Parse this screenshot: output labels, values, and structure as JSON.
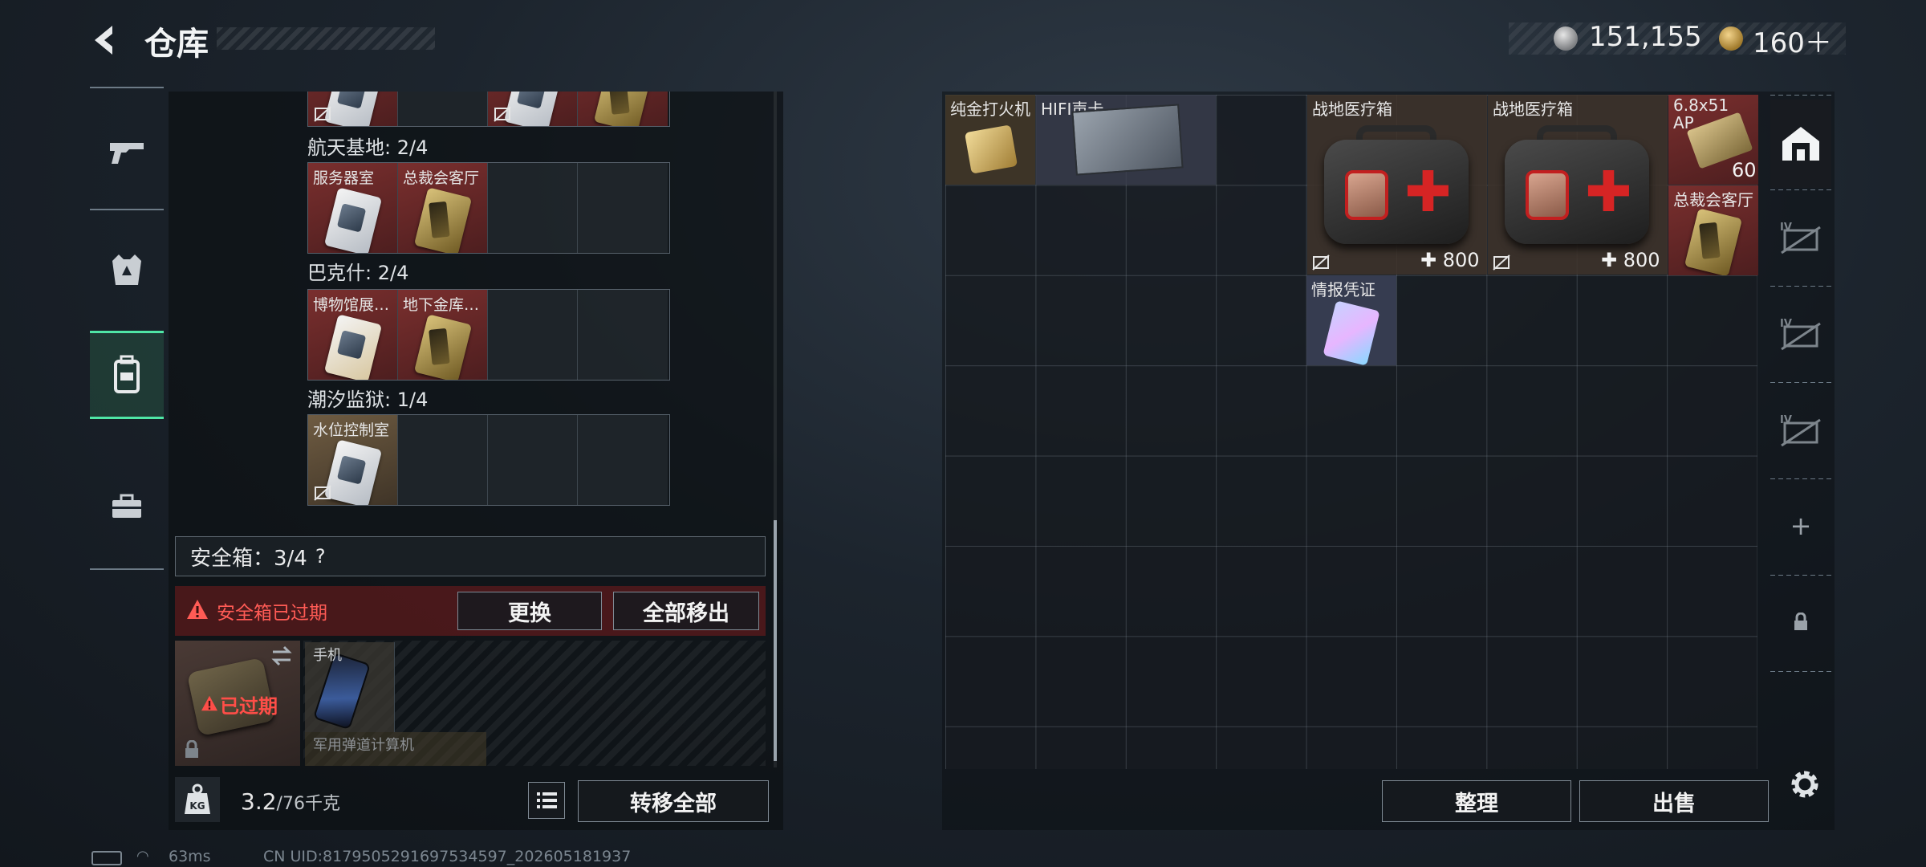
{
  "header": {
    "title": "仓库",
    "currency_silver": "151,155",
    "currency_gold": "160＋"
  },
  "left_panel": {
    "groups": [
      {
        "label": "航天基地: 2/4",
        "items": [
          "服务器室",
          "总裁会客厅"
        ]
      },
      {
        "label": "巴克什: 2/4",
        "items": [
          "博物馆展…",
          "地下金库…"
        ]
      },
      {
        "label": "潮汐监狱: 1/4",
        "items": [
          "水位控制室"
        ]
      }
    ],
    "safebox": {
      "label": "安全箱：3/4",
      "help": "?",
      "expired_notice": "安全箱已过期",
      "change_button": "更换",
      "move_all_button": "全部移出",
      "expired_badge": "已过期",
      "items": [
        "手机",
        "军用弹道计算机"
      ]
    },
    "weight": {
      "current": "3.2",
      "max": "/76千克",
      "unit_badge": "KG"
    },
    "transfer_all_button": "转移全部"
  },
  "stash": {
    "items": [
      {
        "name": "纯金打火机"
      },
      {
        "name": "HIFI声卡"
      },
      {
        "name": "战地医疗箱",
        "durability": "800"
      },
      {
        "name": "战地医疗箱",
        "durability": "800"
      },
      {
        "name": "6.8x51 AP",
        "count": "60"
      },
      {
        "name": "总裁会客厅"
      },
      {
        "name": "情报凭证"
      }
    ],
    "sort_button": "整理",
    "sell_button": "出售",
    "add_tab": "+"
  },
  "status_bar": {
    "ping": "63ms",
    "uid": "CN UID:817950529169753459​7_202605181937"
  },
  "colors": {
    "accent_green": "#4fe6a6",
    "warning_red": "#ff5b55"
  }
}
